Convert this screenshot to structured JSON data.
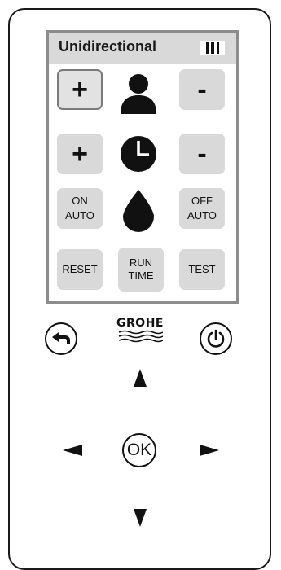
{
  "screen": {
    "mode_title": "Unidirectional",
    "battery_level": 3,
    "rows": [
      {
        "left_label": "+",
        "icon": "person-icon",
        "right_label": "-"
      },
      {
        "left_label": "+",
        "icon": "clock-icon",
        "right_label": "-"
      },
      {
        "left_top": "ON",
        "left_bottom": "AUTO",
        "icon": "water-drop-icon",
        "right_top": "OFF",
        "right_bottom": "AUTO"
      },
      {
        "left_label": "RESET",
        "middle_top": "RUN",
        "middle_bottom": "TIME",
        "right_label": "TEST"
      }
    ],
    "selected_button": "person-plus-button"
  },
  "controls": {
    "logo_text": "GROHE",
    "back_icon": "back-icon",
    "power_icon": "power-icon",
    "ok_label": "OK",
    "arrows": [
      "arrow-up-icon",
      "arrow-left-icon",
      "arrow-right-icon",
      "arrow-down-icon"
    ]
  }
}
